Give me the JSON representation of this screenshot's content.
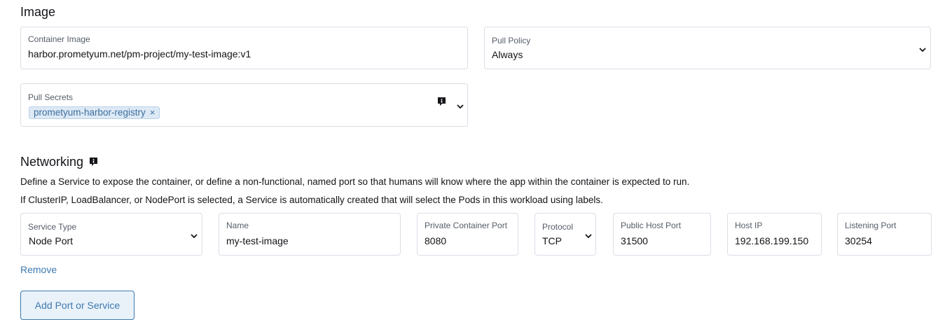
{
  "image_section": {
    "title": "Image",
    "container_image": {
      "label": "Container Image",
      "value": "harbor.prometyum.net/pm-project/my-test-image:v1"
    },
    "pull_policy": {
      "label": "Pull Policy",
      "value": "Always"
    },
    "pull_secrets": {
      "label": "Pull Secrets",
      "tags": [
        "prometyum-harbor-registry"
      ],
      "remove_glyph": "×"
    }
  },
  "networking": {
    "title": "Networking",
    "description_1": "Define a Service to expose the container, or define a non-functional, named port so that humans will know where the app within the container is expected to run.",
    "description_2": "If ClusterIP, LoadBalancer, or NodePort is selected, a Service is automatically created that will select the Pods in this workload using labels.",
    "service_type": {
      "label": "Service Type",
      "value": "Node Port"
    },
    "name": {
      "label": "Name",
      "value": "my-test-image"
    },
    "private_container_port": {
      "label": "Private Container Port",
      "value": "8080"
    },
    "protocol": {
      "label": "Protocol",
      "value": "TCP"
    },
    "public_host_port": {
      "label": "Public Host Port",
      "value": "31500"
    },
    "host_ip": {
      "label": "Host IP",
      "value": "192.168.199.150"
    },
    "listening_port": {
      "label": "Listening Port",
      "value": "30254"
    },
    "remove_label": "Remove",
    "add_button_label": "Add Port or Service"
  },
  "icons": {
    "chevron": "chevron-down-icon",
    "info": "info-icon",
    "tag_remove": "close-icon"
  },
  "colors": {
    "border": "#dcdee7",
    "link": "#3d7ab0",
    "tag_bg": "#dde9f5",
    "text": "#141419",
    "label": "#555c68"
  }
}
